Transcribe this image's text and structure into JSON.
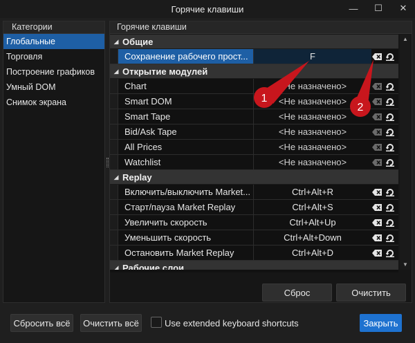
{
  "window": {
    "title": "Горячие клавиши",
    "minimize_glyph": "—",
    "maximize_glyph": "☐",
    "close_glyph": "✕"
  },
  "categories": {
    "header": "Категории",
    "items": [
      "Глобальные",
      "Торговля",
      "Построение графиков",
      "Умный DOM",
      "Снимок экрана"
    ],
    "selected_index": 0
  },
  "hotkeys": {
    "header": "Горячие клавиши",
    "groups": [
      {
        "title": "Общие",
        "rows": [
          {
            "name": "Сохранение рабочего прост...",
            "key": "F",
            "selected": true
          }
        ]
      },
      {
        "title": "Открытие модулей",
        "rows": [
          {
            "name": "Chart",
            "key": "<Не назначено>"
          },
          {
            "name": "Smart DOM",
            "key": "<Не назначено>"
          },
          {
            "name": "Smart Tape",
            "key": "<Не назначено>"
          },
          {
            "name": "Bid/Ask Tape",
            "key": "<Не назначено>"
          },
          {
            "name": "All Prices",
            "key": "<Не назначено>"
          },
          {
            "name": "Watchlist",
            "key": "<Не назначено>"
          }
        ]
      },
      {
        "title": "Replay",
        "rows": [
          {
            "name": "Включить/выключить Market...",
            "key": "Ctrl+Alt+R"
          },
          {
            "name": "Старт/пауза Market Replay",
            "key": "Ctrl+Alt+S"
          },
          {
            "name": "Увеличить скорость",
            "key": "Ctrl+Alt+Up"
          },
          {
            "name": "Уменьшить скорость",
            "key": "Ctrl+Alt+Down"
          },
          {
            "name": "Остановить Market Replay",
            "key": "Ctrl+Alt+D"
          }
        ]
      },
      {
        "title": "Рабочие слои",
        "rows": []
      }
    ],
    "clear_shortcut_icon": "backspace-clear-icon",
    "reset_shortcut_icon": "reset-default-icon"
  },
  "buttons": {
    "reset": "Сброс",
    "clear": "Очистить",
    "reset_all": "Сбросить всё",
    "clear_all": "Очистить всё",
    "close": "Закрыть"
  },
  "extended_shortcuts": {
    "label": "Use extended keyboard shortcuts",
    "checked": false
  },
  "callouts": [
    "1",
    "2"
  ],
  "colors": {
    "accent": "#1e72d0",
    "selection": "#1e5fa5",
    "callout": "#c8161d"
  }
}
